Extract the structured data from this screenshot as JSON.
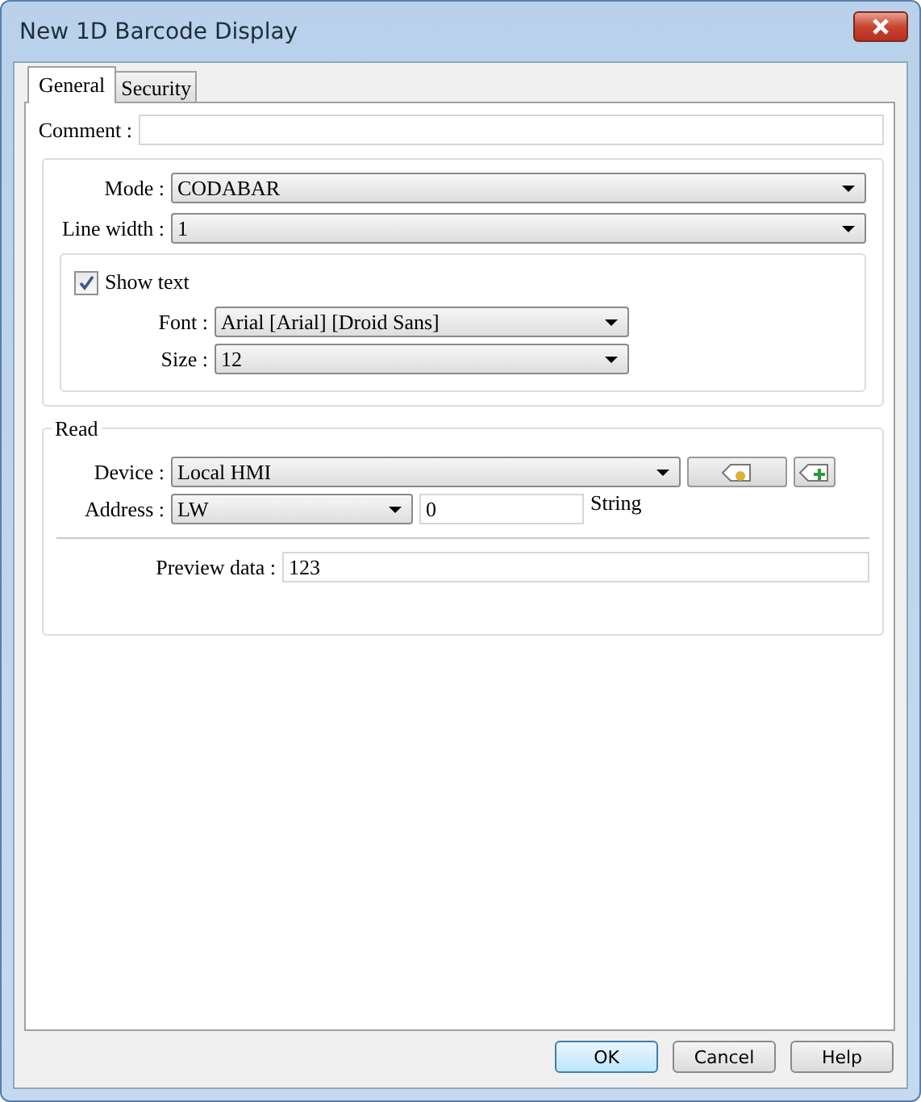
{
  "window": {
    "title": "New 1D Barcode Display"
  },
  "tabs": [
    {
      "label": "General",
      "selected": true
    },
    {
      "label": "Security",
      "selected": false
    }
  ],
  "comment": {
    "label": "Comment :"
  },
  "mode": {
    "label": "Mode :",
    "value": "CODABAR"
  },
  "line_width": {
    "label": "Line width :",
    "value": "1"
  },
  "show_text": {
    "label": "Show text",
    "checked": true
  },
  "font": {
    "label": "Font :",
    "value": "Arial [Arial] [Droid Sans]"
  },
  "size": {
    "label": "Size :",
    "value": "12"
  },
  "read": {
    "title": "Read",
    "device": {
      "label": "Device :",
      "value": "Local HMI"
    },
    "address": {
      "label": "Address :",
      "type": "LW",
      "value": "0",
      "format": "String"
    },
    "preview": {
      "label": "Preview data :",
      "value": "123"
    }
  },
  "buttons": [
    {
      "label": "OK",
      "default": true
    },
    {
      "label": "Cancel",
      "default": false
    },
    {
      "label": "Help",
      "default": false
    }
  ]
}
